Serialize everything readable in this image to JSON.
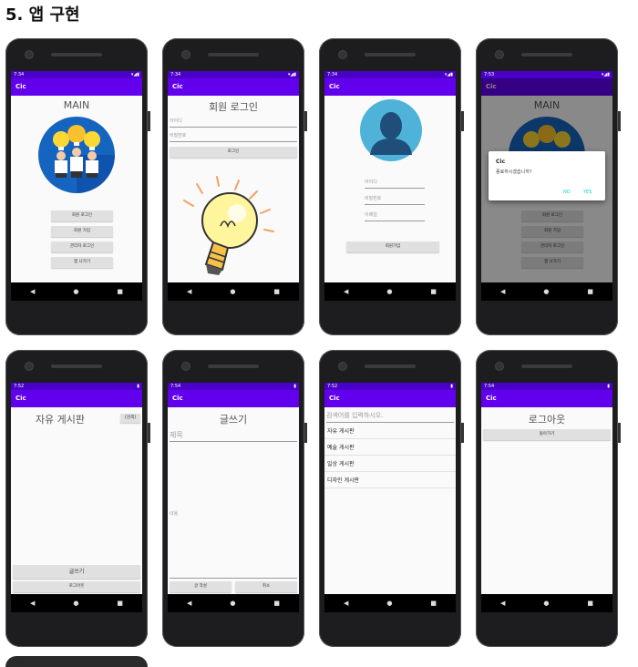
{
  "heading": "5. 앱 구현",
  "status_times": [
    "7:34",
    "7:34",
    "7:34",
    "7:53",
    "7:52",
    "7:54",
    "7:52",
    "7:54"
  ],
  "app_title": "Cic",
  "colors": {
    "appbar": "#6200ee",
    "statusbar": "#4a00c8",
    "accent": "#03dac5"
  },
  "screen1": {
    "title": "MAIN",
    "buttons": [
      "회원 로그인",
      "회원 가입",
      "관리자 로그인",
      "앱 나가기"
    ]
  },
  "screen2": {
    "title": "회원 로그인",
    "id_placeholder": "아이디",
    "pw_placeholder": "비밀번호",
    "login_button": "로그인"
  },
  "screen3": {
    "fields": [
      "아이디",
      "비밀번호",
      "이메일"
    ],
    "register_button": "회원가입"
  },
  "screen4": {
    "title": "MAIN",
    "dialog_title": "Cic",
    "dialog_message": "종료하시겠습니까?",
    "dialog_no": "NO",
    "dialog_yes": "YES",
    "buttons": [
      "회원 로그인",
      "회원 가입",
      "관리자 로그인",
      "앱 나가기"
    ]
  },
  "screen5": {
    "title": "자유 게시판",
    "small_button": "[검색]",
    "write_button": "글쓰기",
    "logout_button": "로그아웃"
  },
  "screen6": {
    "title": "글쓰기",
    "subject_placeholder": "제목",
    "content_placeholder": "내용",
    "submit_button": "글 작성",
    "cancel_button": "취소"
  },
  "screen7": {
    "search_placeholder": "검색어를 입력하시오.",
    "boards": [
      "자유 게시판",
      "예술 게시판",
      "일상 게시판",
      "디자인 게시판"
    ]
  },
  "screen8": {
    "title": "로그아웃",
    "back_button": "돌아가기"
  }
}
